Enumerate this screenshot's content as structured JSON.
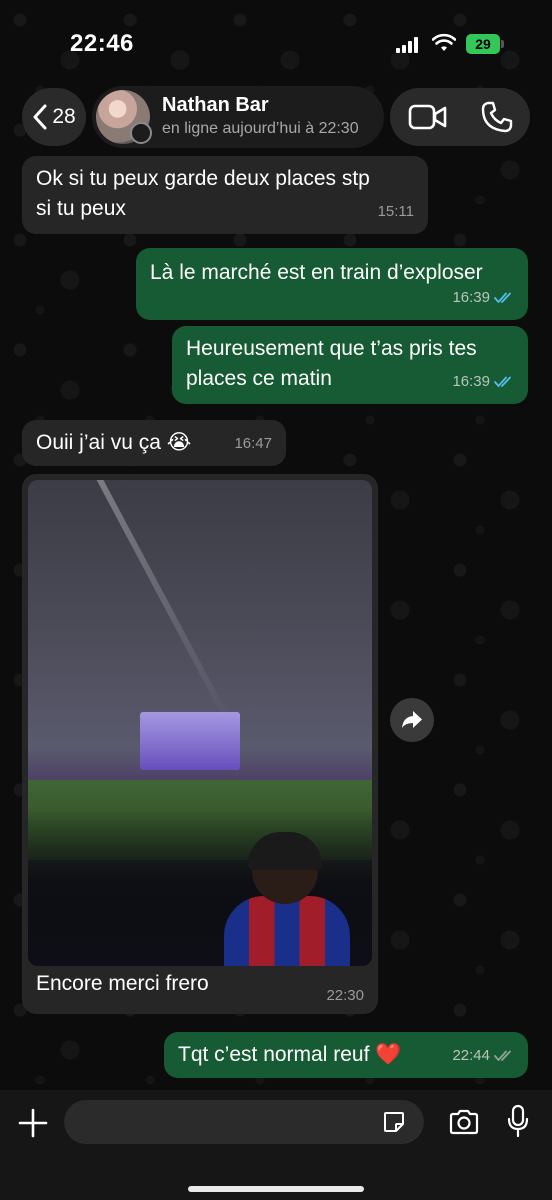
{
  "status_bar": {
    "time": "22:46",
    "battery": "29"
  },
  "header": {
    "back_count": "28",
    "contact_name": "Nathan Bar",
    "contact_status": "en ligne aujourd’hui à 22:30"
  },
  "messages": [
    {
      "direction": "in",
      "text_lines": [
        "Ok si tu peux garde deux places stp",
        "si tu peux"
      ],
      "time": "15:11"
    },
    {
      "direction": "out",
      "text_lines": [
        "Là le marché est en train d’exploser"
      ],
      "time": "16:39",
      "read": true
    },
    {
      "direction": "out",
      "text_lines": [
        "Heureusement que t’as pris tes",
        "places ce matin"
      ],
      "time": "16:39",
      "read": true
    },
    {
      "direction": "in",
      "text_lines": [
        "Ouii j’ai vu ça 😭"
      ],
      "time": "16:47"
    },
    {
      "direction": "in",
      "type": "photo",
      "caption": "Encore merci frero",
      "time": "22:30"
    },
    {
      "direction": "out",
      "text_lines": [
        "Tqt c’est normal reuf ❤️"
      ],
      "time": "22:44",
      "read": true
    }
  ],
  "composer": {
    "placeholder": ""
  },
  "icons": {
    "back": "chevron-left-icon",
    "video_call": "video-camera-icon",
    "voice_call": "phone-icon",
    "forward": "forward-arrow-icon",
    "attach": "plus-icon",
    "sticker": "sticker-icon",
    "camera": "camera-icon",
    "mic": "microphone-icon"
  },
  "colors": {
    "outgoing_bubble": "#165b34",
    "incoming_bubble": "#262626",
    "read_ticks": "#53bdeb",
    "battery": "#33c759"
  }
}
